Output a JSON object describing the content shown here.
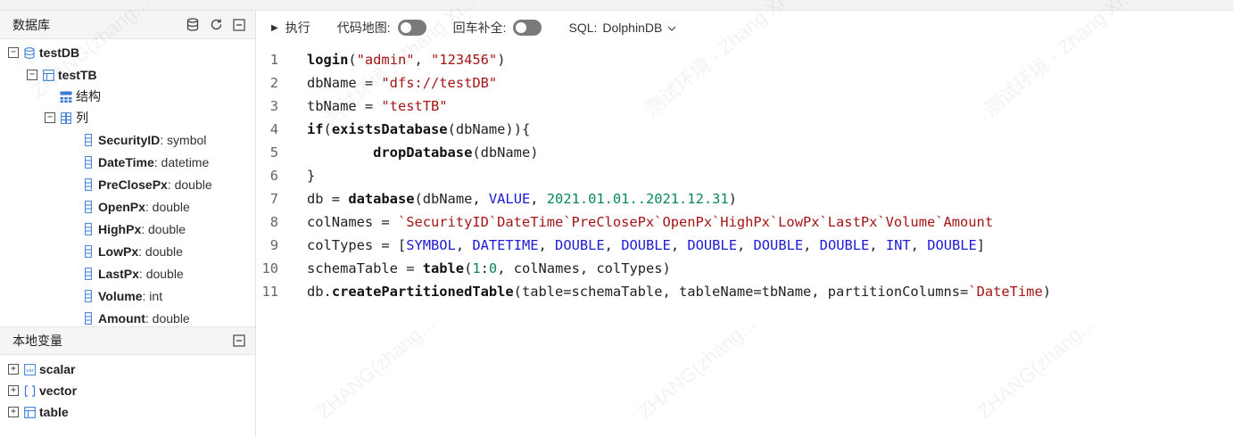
{
  "database_panel": {
    "title": "数据库",
    "icons": [
      "database-icon",
      "refresh-icon",
      "collapse-icon"
    ],
    "tree": {
      "db": "testDB",
      "table": "testTB",
      "schema_label": "结构",
      "columns_label": "列",
      "columns": [
        {
          "name": "SecurityID",
          "type": ": symbol"
        },
        {
          "name": "DateTime",
          "type": ": datetime"
        },
        {
          "name": "PreClosePx",
          "type": ": double"
        },
        {
          "name": "OpenPx",
          "type": ": double"
        },
        {
          "name": "HighPx",
          "type": ": double"
        },
        {
          "name": "LowPx",
          "type": ": double"
        },
        {
          "name": "LastPx",
          "type": ": double"
        },
        {
          "name": "Volume",
          "type": ": int"
        },
        {
          "name": "Amount",
          "type": ": double"
        }
      ]
    }
  },
  "vars_panel": {
    "title": "本地变量",
    "items": [
      "scalar",
      "vector",
      "table"
    ]
  },
  "toolbar": {
    "run_label": "执行",
    "codemap_label": "代码地图:",
    "autocomplete_label": "回车补全:",
    "sql_label": "SQL:",
    "sql_value": "DolphinDB"
  },
  "editor": {
    "line_numbers": [
      "1",
      "2",
      "3",
      "4",
      "5",
      "6",
      "7",
      "8",
      "9",
      "10",
      "11"
    ]
  },
  "watermark": [
    "ZHANG(zhang...",
    "测试环境 - Zhang Xi..."
  ]
}
